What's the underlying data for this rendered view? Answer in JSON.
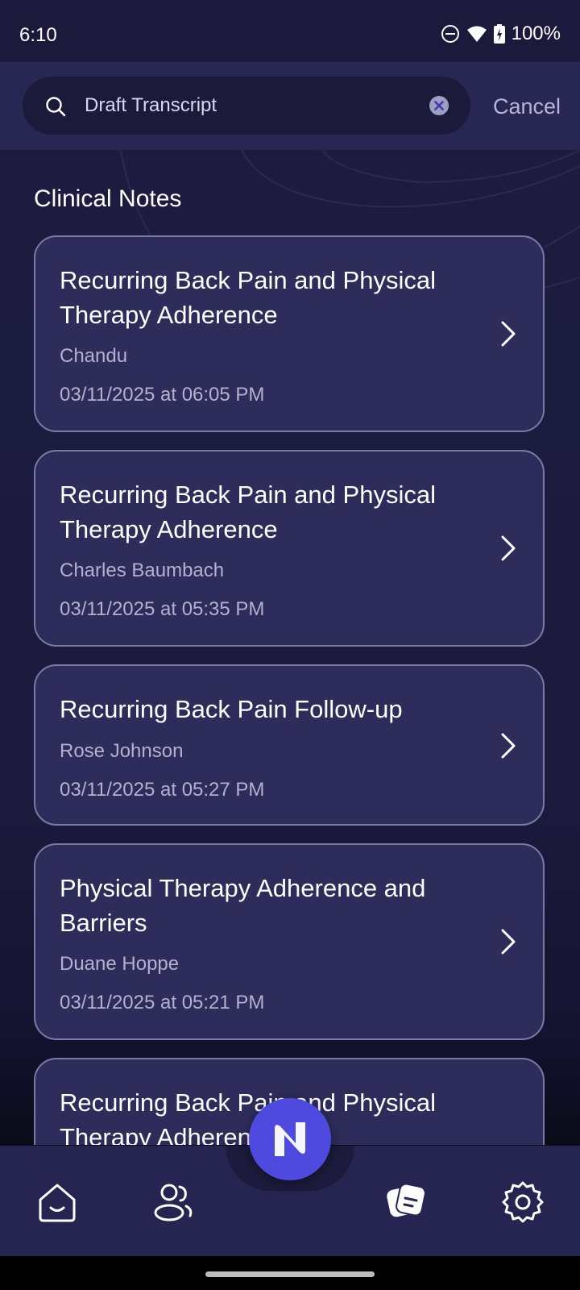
{
  "status_bar": {
    "time": "6:10",
    "battery": "100%"
  },
  "search": {
    "value": "Draft Transcript",
    "cancel_label": "Cancel"
  },
  "section": {
    "title": "Clinical Notes"
  },
  "notes": [
    {
      "title": "Recurring Back Pain and Physical Therapy Adherence",
      "patient": "Chandu",
      "date": "03/11/2025 at 06:05 PM"
    },
    {
      "title": "Recurring Back Pain and Physical Therapy Adherence",
      "patient": "Charles Baumbach",
      "date": "03/11/2025 at 05:35 PM"
    },
    {
      "title": "Recurring Back Pain Follow-up",
      "patient": "Rose Johnson",
      "date": "03/11/2025 at 05:27 PM"
    },
    {
      "title": "Physical Therapy Adherence and Barriers",
      "patient": "Duane Hoppe",
      "date": "03/11/2025 at 05:21 PM"
    },
    {
      "title": "Recurring Back Pain and Physical Therapy Adherence",
      "patient": "",
      "date": ""
    }
  ],
  "bottom_nav": {
    "items": [
      {
        "icon": "home-icon"
      },
      {
        "icon": "patients-icon"
      },
      {
        "icon": "notes-icon"
      },
      {
        "icon": "settings-icon"
      }
    ],
    "fab_icon": "logo-n-icon"
  },
  "colors": {
    "background": "#1d1c40",
    "card": "#2e2c5a",
    "card_border": "#7b79a6",
    "accent": "#4e4ae0"
  }
}
